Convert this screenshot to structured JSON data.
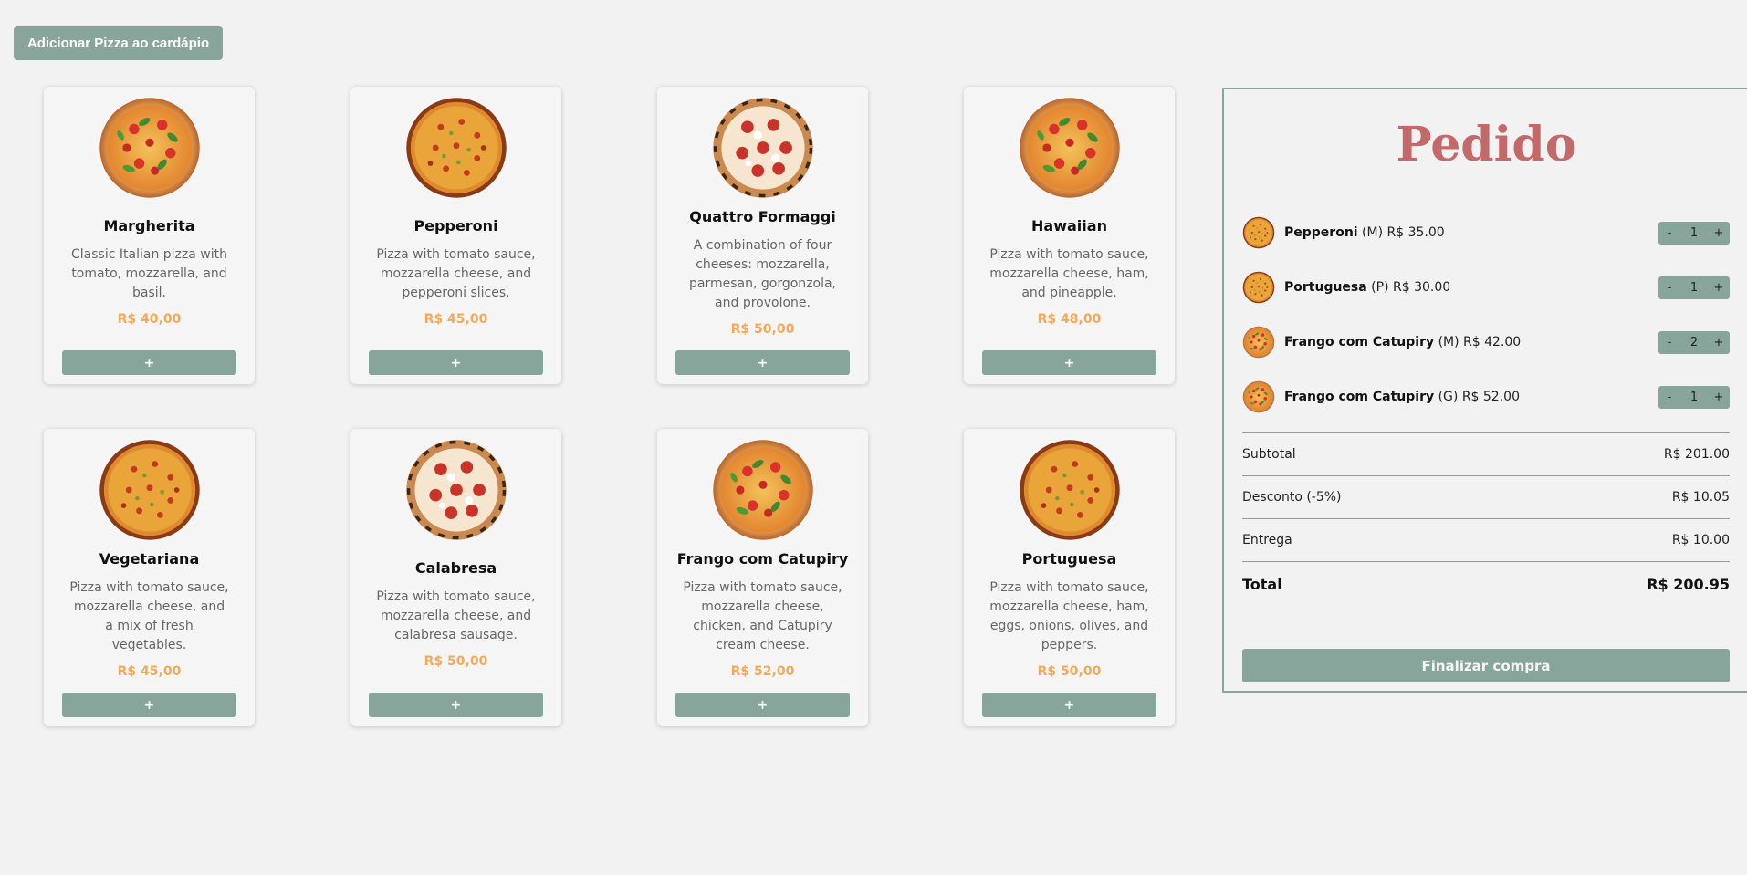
{
  "header": {
    "add_pizza_label": "Adicionar Pizza ao cardápio"
  },
  "menu": [
    {
      "name": "Margherita",
      "description": "Classic Italian pizza with tomato, mozzarella, and basil.",
      "price": "R$ 40,00",
      "add_label": "+",
      "image": "basil-pizza-icon"
    },
    {
      "name": "Pepperoni",
      "description": "Pizza with tomato sauce, mozzarella cheese, and pepperoni slices.",
      "price": "R$ 45,00",
      "add_label": "+",
      "image": "pepperoni-pizza-icon"
    },
    {
      "name": "Quattro Formaggi",
      "description": "A combination of four cheeses: mozzarella, parmesan, gorgonzola, and provolone.",
      "price": "R$ 50,00",
      "add_label": "+",
      "image": "cheese-pizza-icon"
    },
    {
      "name": "Hawaiian",
      "description": "Pizza with tomato sauce, mozzarella cheese, ham, and pineapple.",
      "price": "R$ 48,00",
      "add_label": "+",
      "image": "basil-pizza-icon"
    },
    {
      "name": "Vegetariana",
      "description": "Pizza with tomato sauce, mozzarella cheese, and a mix of fresh vegetables.",
      "price": "R$ 45,00",
      "add_label": "+",
      "image": "pepperoni-pizza-icon"
    },
    {
      "name": "Calabresa",
      "description": "Pizza with tomato sauce, mozzarella cheese, and calabresa sausage.",
      "price": "R$ 50,00",
      "add_label": "+",
      "image": "cheese-pizza-icon"
    },
    {
      "name": "Frango com Catupiry",
      "description": "Pizza with tomato sauce, mozzarella cheese, chicken, and Catupiry cream cheese.",
      "price": "R$ 52,00",
      "add_label": "+",
      "image": "basil-pizza-icon"
    },
    {
      "name": "Portuguesa",
      "description": "Pizza with tomato sauce, mozzarella cheese, ham, eggs, onions, olives, and peppers.",
      "price": "R$ 50,00",
      "add_label": "+",
      "image": "pepperoni-pizza-icon"
    }
  ],
  "order": {
    "title": "Pedido",
    "items": [
      {
        "name": "Pepperoni",
        "size": "(M)",
        "price": "R$ 35.00",
        "qty": "1",
        "minus": "-",
        "plus": "+"
      },
      {
        "name": "Portuguesa",
        "size": "(P)",
        "price": "R$ 30.00",
        "qty": "1",
        "minus": "-",
        "plus": "+"
      },
      {
        "name": "Frango com Catupiry",
        "size": "(M)",
        "price": "R$ 42.00",
        "qty": "2",
        "minus": "-",
        "plus": "+"
      },
      {
        "name": "Frango com Catupiry",
        "size": "(G)",
        "price": "R$ 52.00",
        "qty": "1",
        "minus": "-",
        "plus": "+"
      }
    ],
    "subtotal_label": "Subtotal",
    "subtotal_value": "R$ 201.00",
    "discount_label": "Desconto (-5%)",
    "discount_value": "R$ 10.05",
    "delivery_label": "Entrega",
    "delivery_value": "R$ 10.00",
    "total_label": "Total",
    "total_value": "R$ 200.95",
    "checkout_label": "Finalizar compra"
  },
  "colors": {
    "accent": "#87a59b",
    "price": "#f4a95a",
    "title": "#c4696a",
    "background": "#f2f2f2"
  }
}
